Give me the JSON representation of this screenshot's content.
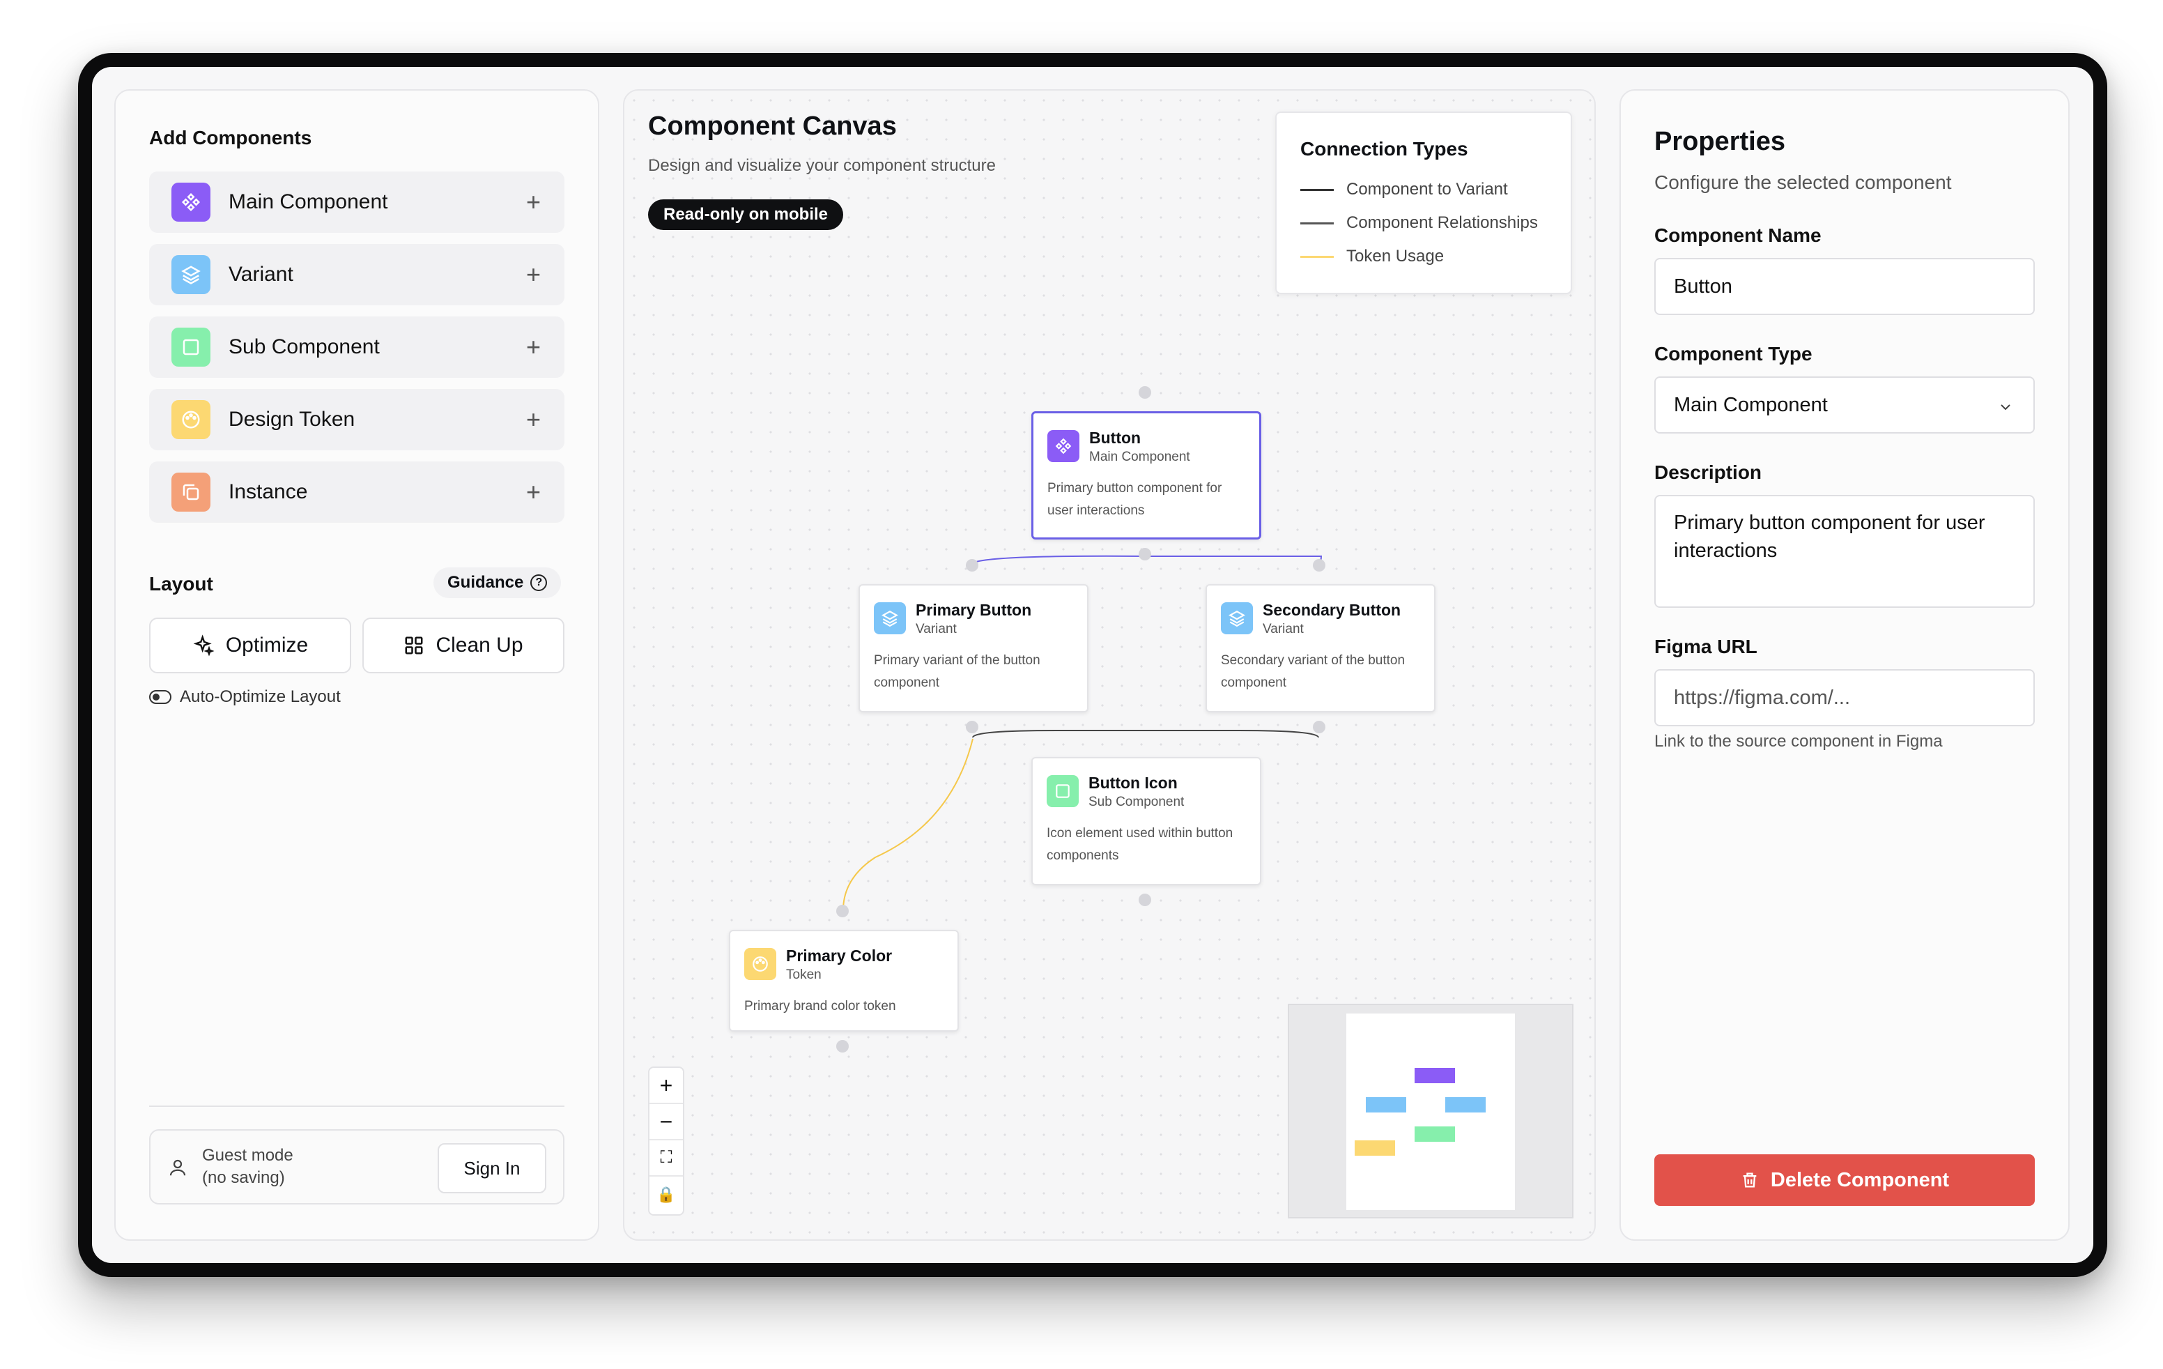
{
  "left_panel": {
    "add_title": "Add Components",
    "components": [
      {
        "label": "Main Component",
        "icon": "component-icon",
        "color": "#8b5cf6"
      },
      {
        "label": "Variant",
        "icon": "layers-icon",
        "color": "#7cc4f8"
      },
      {
        "label": "Sub Component",
        "icon": "square-icon",
        "color": "#86efac"
      },
      {
        "label": "Design Token",
        "icon": "palette-icon",
        "color": "#fcd872"
      },
      {
        "label": "Instance",
        "icon": "copy-icon",
        "color": "#f4a078"
      }
    ],
    "layout_title": "Layout",
    "guidance_label": "Guidance",
    "optimize_label": "Optimize",
    "cleanup_label": "Clean Up",
    "auto_optimize_label": "Auto-Optimize Layout",
    "guest_line1": "Guest mode",
    "guest_line2": "(no saving)",
    "signin_label": "Sign In"
  },
  "canvas": {
    "title": "Component Canvas",
    "subtitle": "Design and visualize your component structure",
    "readonly_badge": "Read-only on mobile",
    "connection_types": {
      "title": "Connection Types",
      "items": [
        {
          "label": "Component to Variant",
          "color": "#333333"
        },
        {
          "label": "Component Relationships",
          "color": "#555555"
        },
        {
          "label": "Token Usage",
          "color": "#fcd872"
        }
      ]
    },
    "nodes": [
      {
        "title": "Button",
        "type": "Main Component",
        "desc": "Primary button component for user interactions",
        "color": "#8b5cf6",
        "icon": "component-icon"
      },
      {
        "title": "Primary Button",
        "type": "Variant",
        "desc": "Primary variant of the button component",
        "color": "#7cc4f8",
        "icon": "layers-icon"
      },
      {
        "title": "Secondary Button",
        "type": "Variant",
        "desc": "Secondary variant of the button component",
        "color": "#7cc4f8",
        "icon": "layers-icon"
      },
      {
        "title": "Button Icon",
        "type": "Sub Component",
        "desc": "Icon element used within button components",
        "color": "#86efac",
        "icon": "square-icon"
      },
      {
        "title": "Primary Color",
        "type": "Token",
        "desc": "Primary brand color token",
        "color": "#fcd872",
        "icon": "palette-icon"
      }
    ],
    "zoom_controls": [
      "+",
      "−",
      "⛶",
      "🔒"
    ]
  },
  "properties": {
    "title": "Properties",
    "subtitle": "Configure the selected component",
    "name_label": "Component Name",
    "name_value": "Button",
    "type_label": "Component Type",
    "type_value": "Main Component",
    "desc_label": "Description",
    "desc_value": "Primary button component for user interactions",
    "figma_label": "Figma URL",
    "figma_placeholder": "https://figma.com/...",
    "figma_hint": "Link to the source component in Figma",
    "delete_label": "Delete Component",
    "delete_color": "#e2524a"
  }
}
